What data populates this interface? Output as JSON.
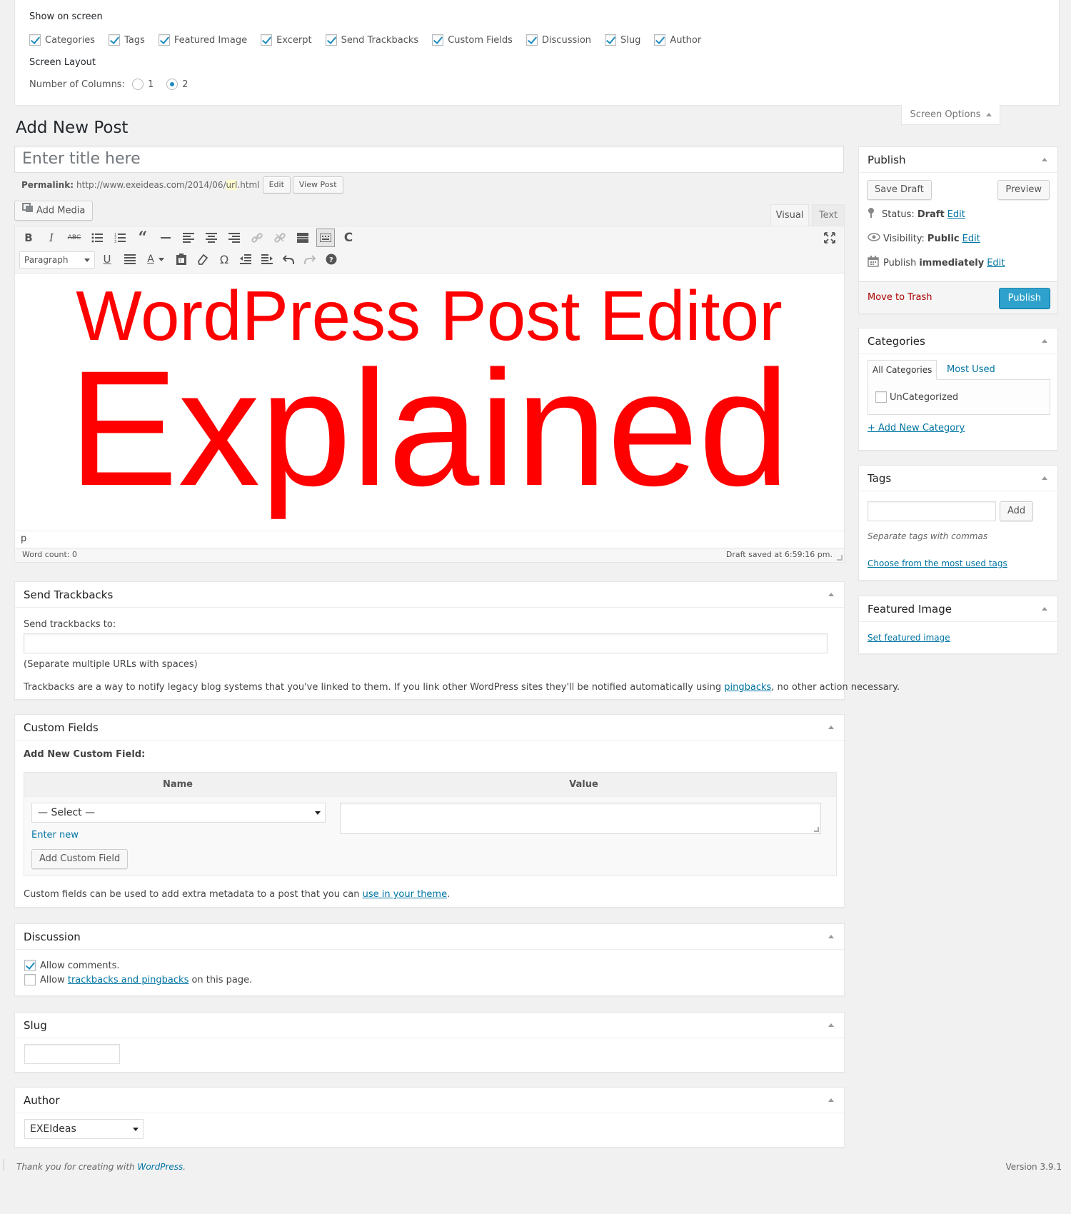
{
  "screen_options": {
    "show_on_screen_label": "Show on screen",
    "checkboxes": [
      {
        "label": "Categories",
        "checked": true
      },
      {
        "label": "Tags",
        "checked": true
      },
      {
        "label": "Featured Image",
        "checked": true
      },
      {
        "label": "Excerpt",
        "checked": true
      },
      {
        "label": "Send Trackbacks",
        "checked": true
      },
      {
        "label": "Custom Fields",
        "checked": true
      },
      {
        "label": "Discussion",
        "checked": true
      },
      {
        "label": "Slug",
        "checked": true
      },
      {
        "label": "Author",
        "checked": true
      }
    ],
    "screen_layout_label": "Screen Layout",
    "columns_label": "Number of Columns:",
    "column_options": [
      "1",
      "2"
    ],
    "selected_columns": "2",
    "tab_label": "Screen Options"
  },
  "page_title": "Add New Post",
  "post": {
    "title_placeholder": "Enter title here",
    "permalink_label": "Permalink:",
    "permalink_prefix": "http://www.exeideas.com/2014/06/",
    "permalink_slug": "url",
    "permalink_suffix": ".html",
    "edit_button": "Edit",
    "view_post_button": "View Post"
  },
  "editor": {
    "add_media_label": "Add Media",
    "tab_visual": "Visual",
    "tab_text": "Text",
    "format_select": "Paragraph",
    "content_line1": "WordPress Post Editor",
    "content_line2": "Explained",
    "content_color": "#ff0000",
    "path": "p",
    "word_count": "Word count: 0",
    "draft_saved": "Draft saved at 6:59:16 pm."
  },
  "trackbacks": {
    "title": "Send Trackbacks",
    "label": "Send trackbacks to:",
    "hint": "(Separate multiple URLs with spaces)",
    "desc_before": "Trackbacks are a way to notify legacy blog systems that you've linked to them. If you link other WordPress sites they'll be notified automatically using ",
    "desc_link": "pingbacks",
    "desc_after": ", no other action necessary."
  },
  "custom_fields": {
    "title": "Custom Fields",
    "add_new_label": "Add New Custom Field:",
    "col_name": "Name",
    "col_value": "Value",
    "select_value": "— Select —",
    "enter_new": "Enter new",
    "add_button": "Add Custom Field",
    "desc_before": "Custom fields can be used to add extra metadata to a post that you can ",
    "desc_link": "use in your theme",
    "desc_after": "."
  },
  "discussion": {
    "title": "Discussion",
    "allow_comments": "Allow comments.",
    "allow_comments_checked": true,
    "allow_pings_before": "Allow ",
    "allow_pings_link": "trackbacks and pingbacks",
    "allow_pings_after": " on this page.",
    "allow_pings_checked": false
  },
  "slug": {
    "title": "Slug",
    "value": ""
  },
  "author": {
    "title": "Author",
    "selected": "EXEIdeas"
  },
  "publish": {
    "title": "Publish",
    "save_draft": "Save Draft",
    "preview": "Preview",
    "status_label": "Status:",
    "status_value": "Draft",
    "visibility_label": "Visibility:",
    "visibility_value": "Public",
    "publish_label": "Publish",
    "publish_value": "immediately",
    "edit_link": "Edit",
    "move_to_trash": "Move to Trash",
    "publish_button": "Publish"
  },
  "categories": {
    "title": "Categories",
    "tab_all": "All Categories",
    "tab_most_used": "Most Used",
    "items": [
      {
        "label": "UnCategorized",
        "checked": false
      }
    ],
    "add_new": "+ Add New Category"
  },
  "tags": {
    "title": "Tags",
    "add_button": "Add",
    "hint": "Separate tags with commas",
    "choose_link": "Choose from the most used tags"
  },
  "featured_image": {
    "title": "Featured Image",
    "set_link": "Set featured image"
  },
  "footer": {
    "thanks_before": "Thank you for creating with ",
    "thanks_link": "WordPress",
    "thanks_after": ".",
    "version": "Version 3.9.1"
  }
}
